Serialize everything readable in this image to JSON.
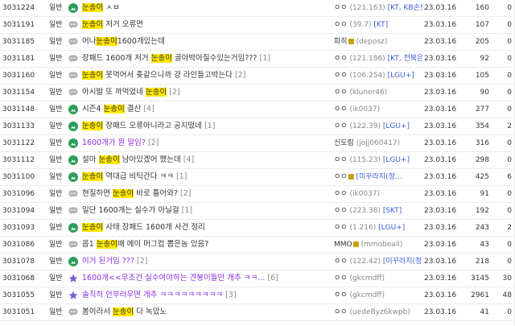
{
  "colors": {
    "highlight": "#ffe600",
    "notice_icon": "#2e9e5a",
    "speech_icon": "#b0b0b0",
    "star_icon": "#7a5cd6",
    "purple_title": "#8a2be2",
    "ip_blue": "#3b5bdb"
  },
  "rows": [
    {
      "num": "3031224",
      "cat": "일반",
      "icon": "image-icon",
      "pre": "",
      "hl": "눈송이",
      "post": " ㅅㅂ",
      "cmt": "",
      "nick": "ㅇㅇ",
      "ip": "(121.163)",
      "tag": "[KT, KB손보...",
      "badge": false,
      "date": "23.03.16",
      "views": "160",
      "rec": "0",
      "purple": false
    },
    {
      "num": "3031191",
      "cat": "일반",
      "icon": "speech-icon",
      "pre": "",
      "hl": "눈송이",
      "post": " 저거 오류면",
      "cmt": "",
      "nick": "ㅇㅇ",
      "ip": "(39.7)",
      "tag": "[KT]",
      "badge": false,
      "date": "23.03.16",
      "views": "107",
      "rec": "0",
      "purple": false
    },
    {
      "num": "3031185",
      "cat": "일반",
      "icon": "speech-icon",
      "pre": "어나",
      "hl": "눈송이",
      "post": "1600개있는데",
      "cmt": "",
      "nick": "피히",
      "ip": "(deposz)",
      "tag": "",
      "badge": true,
      "date": "23.03.16",
      "views": "205",
      "rec": "0",
      "purple": false
    },
    {
      "num": "3031181",
      "cat": "일반",
      "icon": "speech-icon",
      "pre": "장패드 1600개 저거 ",
      "hl": "눈송이",
      "post": " 골아박아질수있는거임???",
      "cmt": "[1]",
      "nick": "ㅇㅇ",
      "ip": "(121.186)",
      "tag": "[KT, 전북은...",
      "badge": false,
      "date": "23.03.16",
      "views": "92",
      "rec": "0",
      "purple": false
    },
    {
      "num": "3031160",
      "cat": "일반",
      "icon": "speech-icon",
      "pre": "",
      "hl": "눈송이",
      "post": " 못먹어서 좆같으니까 걍 라인들고박는다",
      "cmt": "[2]",
      "nick": "ㅇㅇ",
      "ip": "(106.254)",
      "tag": "[LGU+]",
      "badge": false,
      "date": "23.03.16",
      "views": "105",
      "rec": "0",
      "purple": false
    },
    {
      "num": "3031154",
      "cat": "일반",
      "icon": "speech-icon",
      "pre": "아시발 또 까먹었네 ",
      "hl": "눈송이",
      "post": "",
      "cmt": "[2]",
      "nick": "ㅇㅇ",
      "ip": "(kluner46)",
      "tag": "",
      "badge": false,
      "date": "23.03.16",
      "views": "90",
      "rec": "0",
      "purple": false
    },
    {
      "num": "3031148",
      "cat": "일반",
      "icon": "image-icon",
      "pre": "시즌4 ",
      "hl": "눈송이",
      "post": " 결산",
      "cmt": "[4]",
      "nick": "ㅇㅇ",
      "ip": "(ik0037)",
      "tag": "",
      "badge": false,
      "date": "23.03.16",
      "views": "277",
      "rec": "0",
      "purple": false
    },
    {
      "num": "3031133",
      "cat": "일반",
      "icon": "image-icon",
      "pre": "",
      "hl": "눈송이",
      "post": " 장패드 오류아니라고 공지떴네",
      "cmt": "[1]",
      "nick": "ㅇㅇ",
      "ip": "(122.39)",
      "tag": "[LGU+]",
      "badge": false,
      "date": "23.03.16",
      "views": "354",
      "rec": "2",
      "purple": false
    },
    {
      "num": "3031122",
      "cat": "일반",
      "icon": "image-icon",
      "pre": "1600개가 뭔 말임?",
      "hl": "",
      "post": "",
      "cmt": "[2]",
      "nick": "신도림",
      "ip": "(jojj060417)",
      "tag": "",
      "badge": false,
      "date": "23.03.16",
      "views": "316",
      "rec": "0",
      "purple": true
    },
    {
      "num": "3031112",
      "cat": "일반",
      "icon": "image-icon",
      "pre": "설마 ",
      "hl": "눈송이",
      "post": " 남아있겠어 했는데",
      "cmt": "[4]",
      "nick": "ㅇㅇ",
      "ip": "(115.23)",
      "tag": "[LGU+]",
      "badge": false,
      "date": "23.03.16",
      "views": "298",
      "rec": "0",
      "purple": false
    },
    {
      "num": "3031100",
      "cat": "일반",
      "icon": "image-icon",
      "pre": "",
      "hl": "눈송이",
      "post": " 역대급 비틱간다 ㅋㅋ",
      "cmt": "[1]",
      "nick": "ㅇㅇ",
      "ip": "",
      "tag": "[미꾸라지(정...",
      "badge": true,
      "date": "23.03.16",
      "views": "425",
      "rec": "6",
      "purple": false
    },
    {
      "num": "3031096",
      "cat": "일반",
      "icon": "speech-icon",
      "pre": "현질하면 ",
      "hl": "눈송이",
      "post": " 바로 틀어와?",
      "cmt": "[2]",
      "nick": "ㅇㅇ",
      "ip": "(ik0037)",
      "tag": "",
      "badge": false,
      "date": "23.03.16",
      "views": "91",
      "rec": "0",
      "purple": false
    },
    {
      "num": "3031094",
      "cat": "일반",
      "icon": "speech-icon",
      "pre": "일단 1600개는 실수가 아닐걸",
      "cmt": "[1]",
      "hl": "",
      "post": "",
      "nick": "ㅇㅇ",
      "ip": "(223.38)",
      "tag": "[SKT]",
      "badge": false,
      "date": "23.03.16",
      "views": "192",
      "rec": "0",
      "purple": false
    },
    {
      "num": "3031093",
      "cat": "일반",
      "icon": "image-icon",
      "pre": "",
      "hl": "눈송이",
      "post": " 사태 장패드 1600개 사건 정리",
      "cmt": "",
      "nick": "ㅇㅇ",
      "ip": "(1.216)",
      "tag": "[LGU+]",
      "badge": false,
      "date": "23.03.16",
      "views": "243",
      "rec": "2",
      "purple": false
    },
    {
      "num": "3031086",
      "cat": "일반",
      "icon": "speech-icon",
      "pre": "옵1 ",
      "hl": "눈송이",
      "post": "때 메이 머그컵 뽑은놈 있음?",
      "cmt": "",
      "nick": "MMO",
      "ip": "(mmobeall)",
      "tag": "",
      "badge": true,
      "date": "23.03.16",
      "views": "43",
      "rec": "0",
      "purple": false
    },
    {
      "num": "3031078",
      "cat": "일반",
      "icon": "image-icon",
      "pre": "이거 된거임 ???",
      "hl": "",
      "post": "",
      "cmt": "[2]",
      "nick": "ㅇㅇ",
      "ip": "(122.42)",
      "tag": "[미꾸라지(정...",
      "badge": false,
      "date": "23.03.16",
      "views": "218",
      "rec": "0",
      "purple": true
    },
    {
      "num": "3031068",
      "cat": "일반",
      "icon": "star-icon",
      "pre": "1600개<<무조건 실수여야하는 견봉이들만 개추 ㅋㅋ...",
      "hl": "",
      "post": "",
      "cmt": "[6]",
      "nick": "ㅇㅇ",
      "ip": "(gkcmdff)",
      "tag": "",
      "badge": false,
      "date": "23.03.16",
      "views": "3145",
      "rec": "30",
      "purple": true
    },
    {
      "num": "3031055",
      "cat": "일반",
      "icon": "star-icon",
      "pre": "솔직히 안부러우면 개추 ㅋㅋㅋㅋㅋㅋㅋㅋㅋ",
      "hl": "",
      "post": "",
      "cmt": "[3]",
      "nick": "ㅇㅇ",
      "ip": "(gkcmdff)",
      "tag": "",
      "badge": false,
      "date": "23.03.16",
      "views": "2961",
      "rec": "48",
      "purple": true
    },
    {
      "num": "3031051",
      "cat": "일반",
      "icon": "speech-icon",
      "pre": "봄이라서 ",
      "hl": "눈송이",
      "post": " 다 녹았노",
      "cmt": "",
      "nick": "ㅇㅇ",
      "ip": "(uedeByz6kwpb)",
      "tag": "",
      "badge": false,
      "date": "23.03.16",
      "views": "41",
      "rec": "0",
      "purple": false
    }
  ]
}
